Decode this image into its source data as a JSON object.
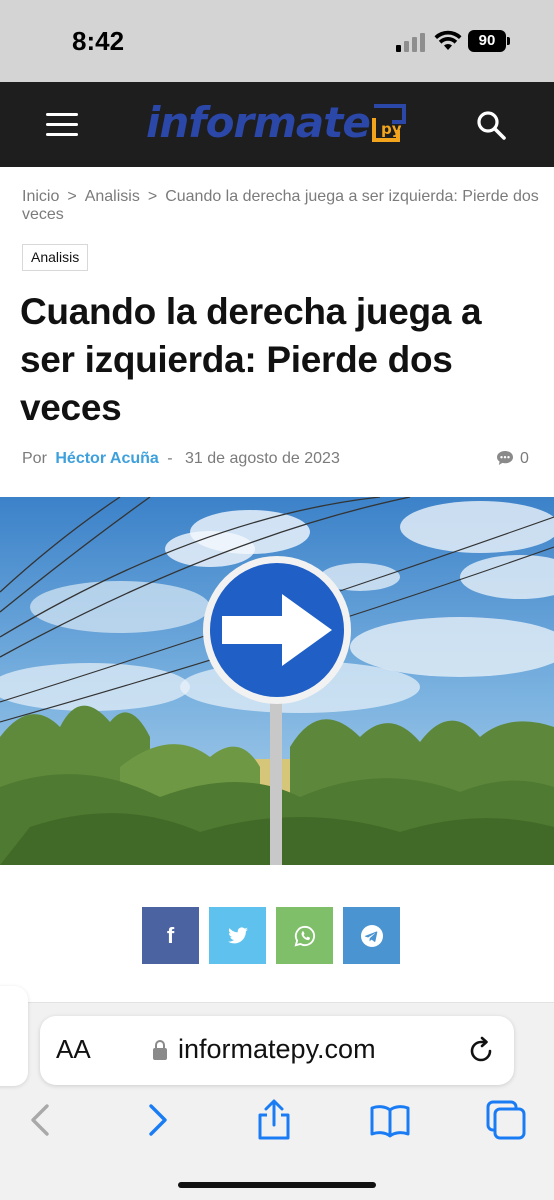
{
  "status_bar": {
    "time": "8:42",
    "battery": "90"
  },
  "header": {
    "logo_text": "informate",
    "logo_mark": "py",
    "menu_icon": "hamburger-menu-icon",
    "search_icon": "search-icon"
  },
  "breadcrumb": {
    "items": [
      "Inicio",
      "Analisis",
      "Cuando la derecha juega a ser izquierda: Pierde dos veces"
    ],
    "separator": ">"
  },
  "article": {
    "category": "Analisis",
    "title": "Cuando la derecha juega a ser izquierda: Pierde dos veces",
    "by_label": "Por",
    "author": "Héctor Acuña",
    "date_separator": "-",
    "date": "31 de agosto de 2023",
    "comment_count": "0",
    "image_alt": "Blue round road sign with white arrow pointing right, bushes and sky"
  },
  "share": {
    "buttons": [
      {
        "network": "facebook",
        "icon": "facebook-icon",
        "glyph": "f",
        "color": "#4b63a0"
      },
      {
        "network": "twitter",
        "icon": "twitter-icon",
        "color": "#5fc2ee"
      },
      {
        "network": "whatsapp",
        "icon": "whatsapp-icon",
        "color": "#7fbf6a"
      },
      {
        "network": "telegram",
        "icon": "telegram-icon",
        "color": "#4a94d1"
      }
    ]
  },
  "browser": {
    "text_size_label": "AA",
    "url": "informatepy.com",
    "toolbar": [
      "back-icon",
      "forward-icon",
      "share-icon",
      "bookmarks-icon",
      "tabs-icon"
    ]
  },
  "colors": {
    "header_bg": "#1e1e1e",
    "logo_blue": "#2b47a8",
    "logo_gold": "#f2a51c",
    "author_link": "#3ea0dc",
    "ios_blue": "#1a7cf5"
  }
}
